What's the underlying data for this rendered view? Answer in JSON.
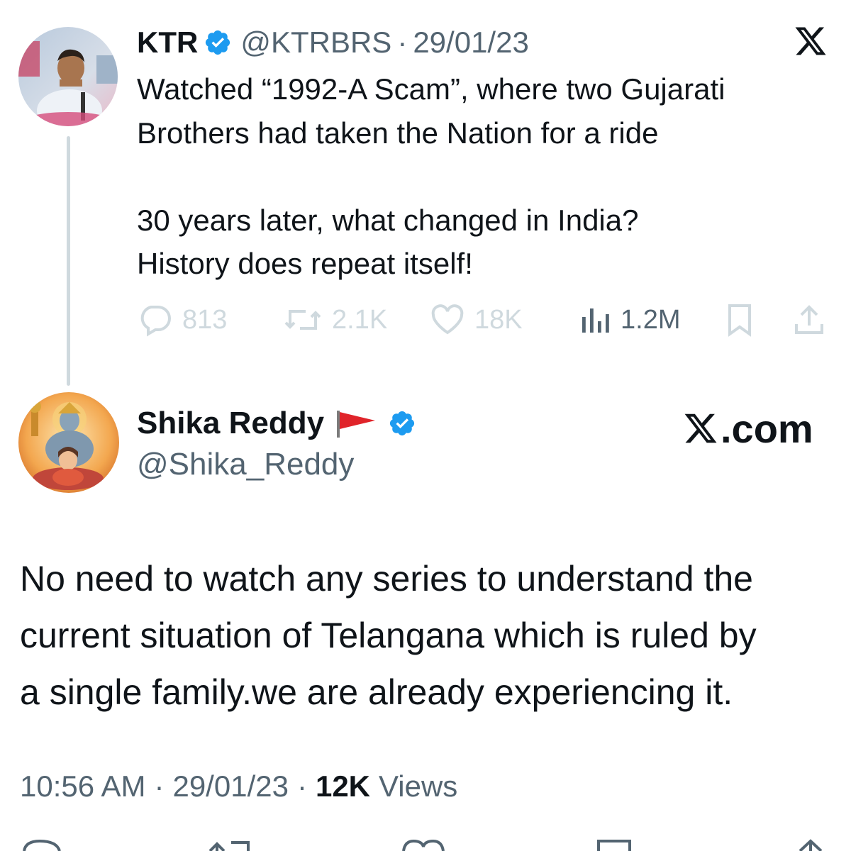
{
  "parent_tweet": {
    "name": "KTR",
    "handle": "@KTRBRS",
    "separator": "·",
    "date": "29/01/23",
    "lines": [
      "Watched “1992-A Scam”, where two Gujarati",
      "Brothers had taken the Nation for a ride",
      "",
      "30 years later, what changed in India?",
      "History does repeat itself!"
    ],
    "stats": {
      "replies": "813",
      "reposts": "2.1K",
      "likes": "18K",
      "views": "1.2M"
    }
  },
  "reply_tweet": {
    "name": "Shika Reddy",
    "handle": "@Shika_Reddy",
    "brand": ".com",
    "lines": [
      "No  need to watch any series to understand the",
      "current situation of Telangana which is ruled by",
      "a single family.we are already experiencing it."
    ],
    "time": "10:56 AM",
    "separator": "·",
    "date": "29/01/23",
    "views_count": "12K",
    "views_label": "Views"
  },
  "icons": {
    "verified": "verified-badge-icon",
    "x_logo": "x-logo-icon",
    "reply": "reply-icon",
    "repost": "repost-icon",
    "like": "heart-icon",
    "views": "views-bar-chart-icon",
    "bookmark": "bookmark-icon",
    "share": "share-icon",
    "flag": "red-flag-icon"
  },
  "colors": {
    "text_primary": "#0f1419",
    "text_secondary": "#536471",
    "verified_blue": "#1d9bf0",
    "faded_action": "#cfd9de",
    "flag_red": "#e0242a"
  }
}
